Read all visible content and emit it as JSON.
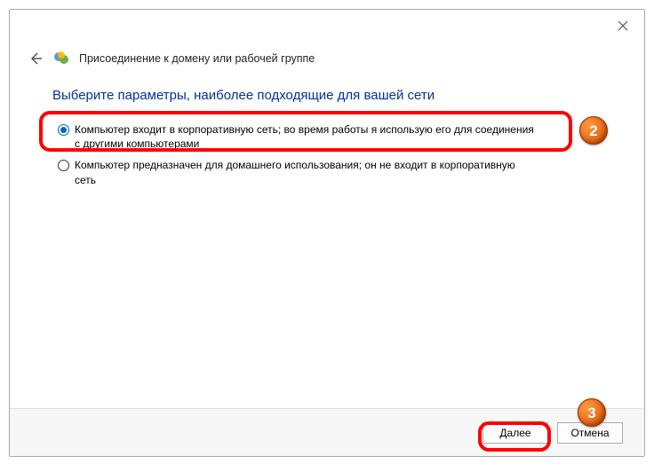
{
  "window": {
    "title": "Присоединение к домену или рабочей группе",
    "close_tooltip": "Закрыть"
  },
  "heading": "Выберите параметры, наиболее подходящие для вашей сети",
  "options": {
    "corporate": "Компьютер входит в корпоративную сеть; во время работы я использую его для соединения с другими компьютерами",
    "home": "Компьютер предназначен для домашнего использования; он не входит в корпоративную сеть"
  },
  "buttons": {
    "next": "Далее",
    "cancel": "Отмена"
  },
  "annotations": {
    "step2": "2",
    "step3": "3"
  }
}
